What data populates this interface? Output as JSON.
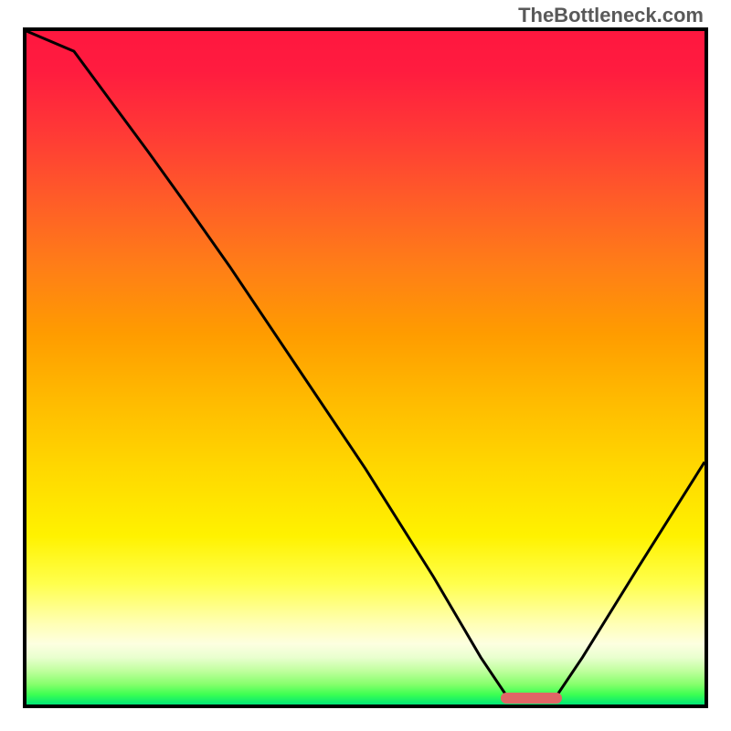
{
  "watermark": "TheBottleneck.com",
  "chart_data": {
    "type": "line",
    "title": "",
    "xlabel": "",
    "ylabel": "",
    "xlim": [
      0,
      100
    ],
    "ylim": [
      0,
      100
    ],
    "grid": false,
    "description": "Bottleneck curve over rainbow gradient. Y ~ bottleneck % (top=100, bottom=0). X ~ configuration parameter. Curve descends from top-left, reaches a flat minimum near x=71-78, then rises toward the right edge.",
    "series": [
      {
        "name": "bottleneck-curve",
        "x": [
          0,
          7,
          18,
          23,
          30,
          40,
          50,
          60,
          67,
          71,
          75,
          78,
          82,
          90,
          100
        ],
        "y": [
          100,
          97,
          82,
          75,
          65,
          50,
          35,
          19,
          7,
          1,
          1,
          1,
          7,
          20,
          36
        ]
      }
    ],
    "optimal_range": {
      "x_start": 70,
      "x_end": 79,
      "y": 1
    },
    "gradient_stops": [
      {
        "pct": 0,
        "color": "#ff173f"
      },
      {
        "pct": 25,
        "color": "#ff5c28"
      },
      {
        "pct": 50,
        "color": "#ffc800"
      },
      {
        "pct": 75,
        "color": "#fff200"
      },
      {
        "pct": 92,
        "color": "#fcffdd"
      },
      {
        "pct": 100,
        "color": "#00e676"
      }
    ]
  }
}
